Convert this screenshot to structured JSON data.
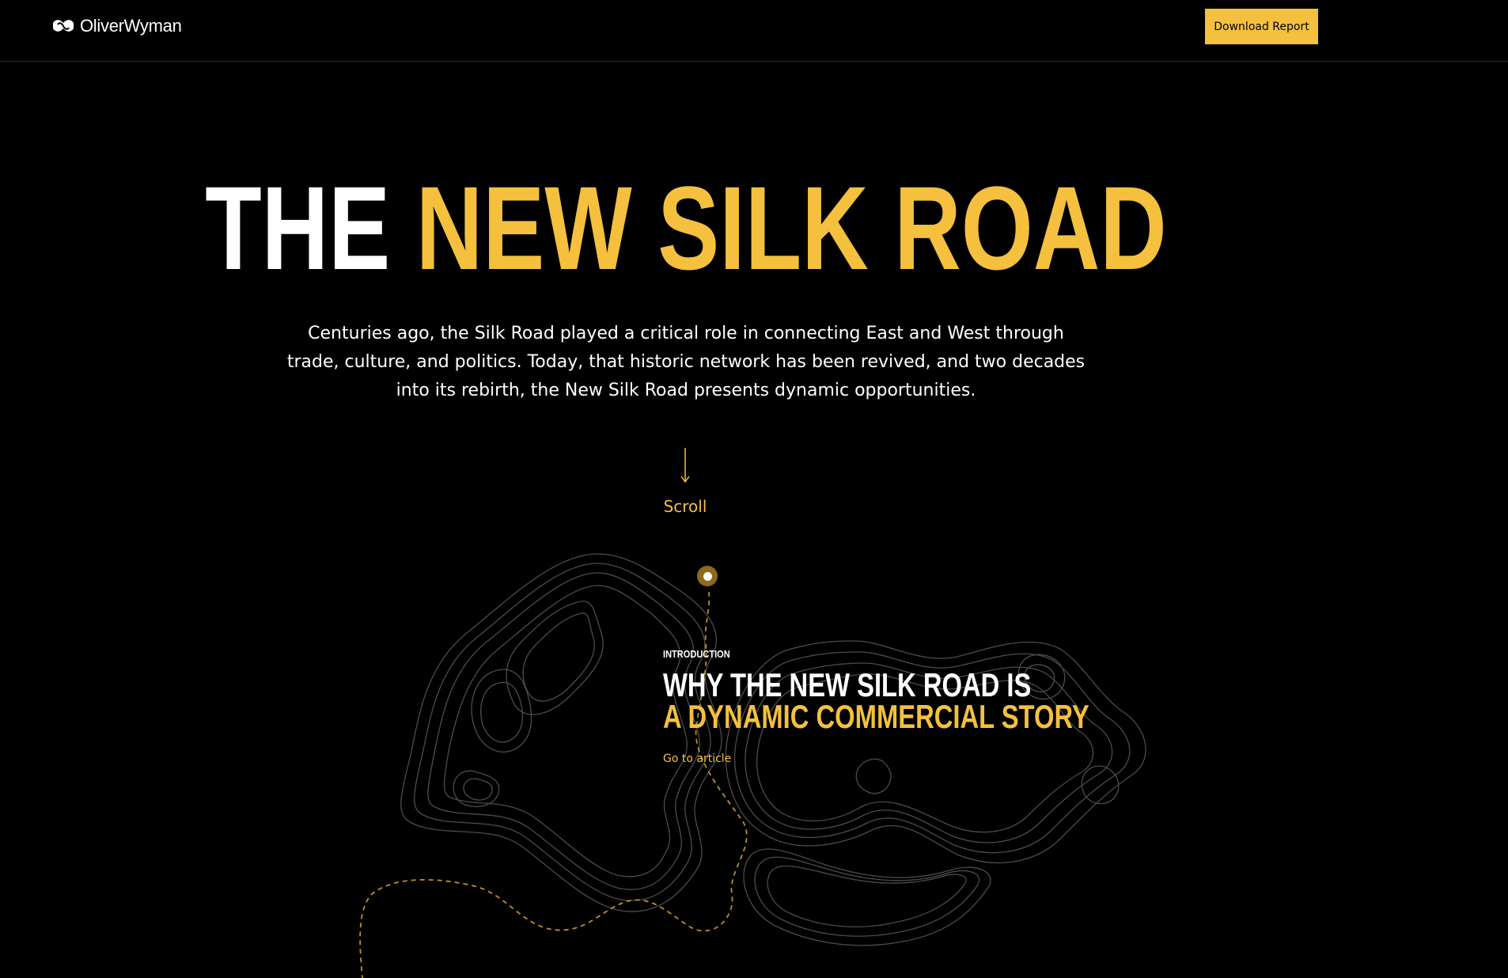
{
  "header": {
    "logo_text": "OliverWyman",
    "download_label": "Download Report"
  },
  "hero": {
    "title_white": "THE",
    "title_yellow": "NEW SILK ROAD",
    "subtitle": "Centuries ago, the Silk Road played a critical role in connecting East and West through trade, culture, and politics. Today, that historic network has been revived, and two decades into its rebirth, the New Silk Road presents dynamic opportunities.",
    "scroll_label": "Scroll"
  },
  "intro": {
    "eyebrow": "INTRODUCTION",
    "title_line1": "WHY THE NEW SILK ROAD IS",
    "title_line2": "A DYNAMIC COMMERCIAL STORY",
    "link_label": "Go to article"
  },
  "colors": {
    "background": "#000000",
    "accent": "#f4c03e",
    "text": "#ffffff"
  },
  "icons": [
    "oliver-wyman-logo-icon",
    "arrow-down-icon",
    "map-pin-icon"
  ]
}
